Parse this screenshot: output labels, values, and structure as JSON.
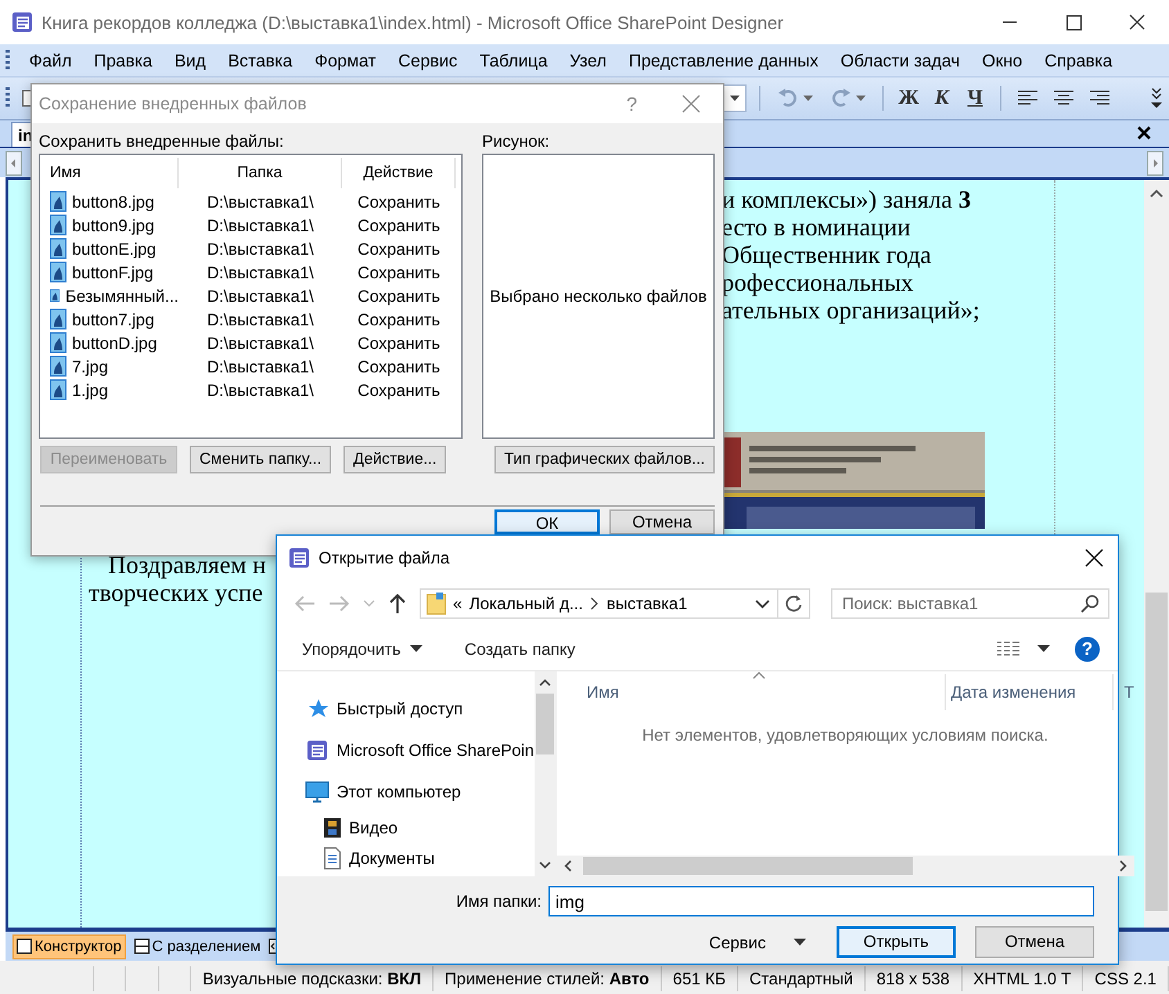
{
  "window": {
    "title": "Книга рекордов колледжа (D:\\выставка1\\index.html) - Microsoft Office SharePoint Designer"
  },
  "menu": [
    "Файл",
    "Правка",
    "Вид",
    "Вставка",
    "Формат",
    "Сервис",
    "Таблица",
    "Узел",
    "Представление данных",
    "Области задач",
    "Окно",
    "Справка"
  ],
  "toolbar": {
    "format_buttons": [
      "Ж",
      "К",
      "Ч"
    ]
  },
  "document_tab": {
    "label": "in"
  },
  "document": {
    "right_lines": [
      "и комплексы») заняла **3**",
      "есто в номинации",
      "Общественник года",
      "рофессиональных",
      "ательных организаций»;"
    ],
    "left_lines": [
      "Поздравляем н",
      "творческих успе"
    ]
  },
  "view_tabs": [
    {
      "label": "Конструктор",
      "selected": true
    },
    {
      "label": "С разделением",
      "selected": false
    }
  ],
  "status_bar": [
    "Визуальные подсказки: **ВКЛ**",
    "Применение стилей: **Авто**",
    "651 КБ",
    "Стандартный",
    "818 x 538",
    "XHTML 1.0 T",
    "CSS 2.1"
  ],
  "save_dialog": {
    "title": "Сохранение внедренных файлов",
    "help_button": "?",
    "list_label": "Сохранить внедренные файлы:",
    "columns": [
      "Имя",
      "Папка",
      "Действие"
    ],
    "rows": [
      {
        "name": "button8.jpg",
        "folder": "D:\\выставка1\\",
        "action": "Сохранить"
      },
      {
        "name": "button9.jpg",
        "folder": "D:\\выставка1\\",
        "action": "Сохранить"
      },
      {
        "name": "buttonE.jpg",
        "folder": "D:\\выставка1\\",
        "action": "Сохранить"
      },
      {
        "name": "buttonF.jpg",
        "folder": "D:\\выставка1\\",
        "action": "Сохранить"
      },
      {
        "name": "Безымянный...",
        "folder": "D:\\выставка1\\",
        "action": "Сохранить"
      },
      {
        "name": "button7.jpg",
        "folder": "D:\\выставка1\\",
        "action": "Сохранить"
      },
      {
        "name": "buttonD.jpg",
        "folder": "D:\\выставка1\\",
        "action": "Сохранить"
      },
      {
        "name": "7.jpg",
        "folder": "D:\\выставка1\\",
        "action": "Сохранить"
      },
      {
        "name": "1.jpg",
        "folder": "D:\\выставка1\\",
        "action": "Сохранить"
      }
    ],
    "preview_label": "Рисунок:",
    "preview_text": "Выбрано несколько файлов",
    "buttons": [
      {
        "label": "Переименовать",
        "disabled": true
      },
      {
        "label": "Сменить папку...",
        "disabled": false
      },
      {
        "label": "Действие...",
        "disabled": false
      },
      {
        "label": "Тип графических файлов...",
        "disabled": false
      }
    ],
    "footer_buttons": [
      {
        "label": "ОК",
        "default": true
      },
      {
        "label": "Отмена",
        "default": false
      }
    ]
  },
  "open_dialog": {
    "title": "Открытие файла",
    "address": {
      "prefix": "«",
      "segments": [
        "Локальный д...",
        "выставка1"
      ]
    },
    "search": {
      "placeholder": "Поиск: выставка1"
    },
    "commands": [
      {
        "label": "Упорядочить",
        "dropdown": true
      },
      {
        "label": "Создать папку",
        "dropdown": false
      }
    ],
    "help_button": "?",
    "nav": [
      {
        "label": "Быстрый доступ",
        "kind": "star"
      },
      {
        "label": "Microsoft Office SharePoin",
        "kind": "app"
      },
      {
        "label": "Этот компьютер",
        "kind": "computer",
        "children": [
          {
            "label": "Видео",
            "kind": "video"
          },
          {
            "label": "Документы",
            "kind": "document"
          }
        ]
      }
    ],
    "columns": [
      "Имя",
      "Дата изменения",
      "Т"
    ],
    "empty_message": "Нет элементов, удовлетворяющих условиям поиска.",
    "folder_field": {
      "label": "Имя папки:",
      "value": "img"
    },
    "buttons": [
      {
        "label": "Сервис",
        "kind": "menu",
        "default": false
      },
      {
        "label": "Открыть",
        "kind": "push",
        "default": true
      },
      {
        "label": "Отмена",
        "kind": "push",
        "default": false
      }
    ]
  }
}
